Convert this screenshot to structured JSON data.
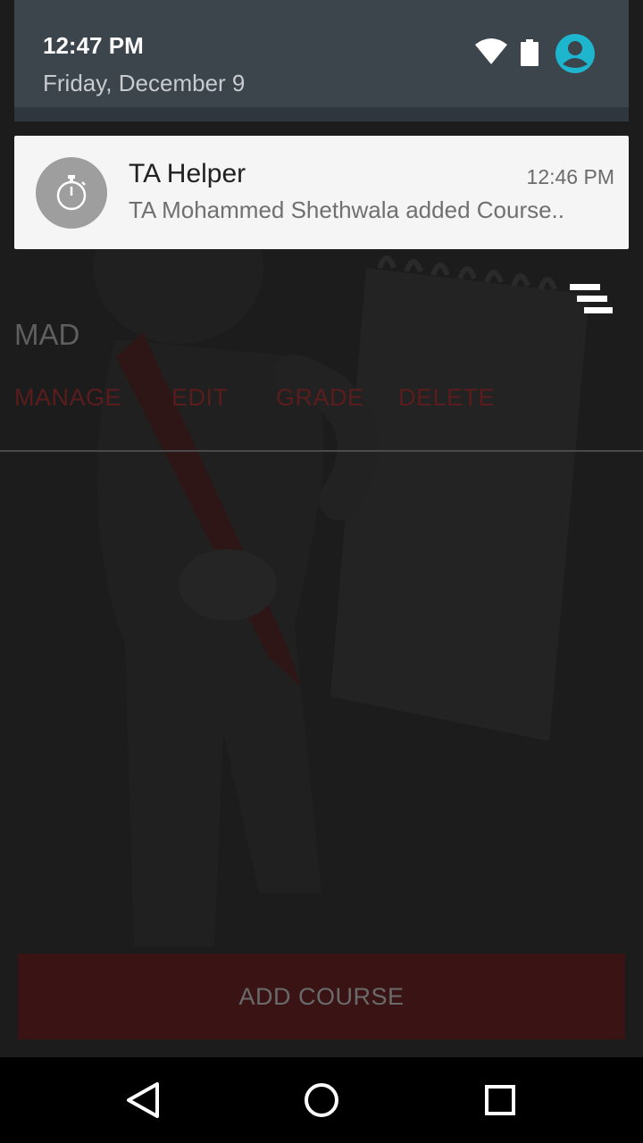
{
  "status": {
    "time": "12:47 PM",
    "date": "Friday, December 9",
    "icons": [
      "wifi-icon",
      "battery-icon",
      "account-icon"
    ]
  },
  "notification": {
    "app_name": "TA Helper",
    "time": "12:46 PM",
    "text": "TA Mohammed Shethwala added Course..",
    "icon": "stopwatch-icon"
  },
  "course": {
    "name": "MAD",
    "actions": [
      "MANAGE",
      "EDIT",
      "GRADE",
      "DELETE"
    ]
  },
  "add_course_label": "ADD COURSE",
  "colors": {
    "accent": "#3a1414",
    "action_text": "#5a1c1c",
    "account_icon": "#1eb6cf"
  },
  "nav": [
    "back-icon",
    "home-icon",
    "recents-icon"
  ]
}
